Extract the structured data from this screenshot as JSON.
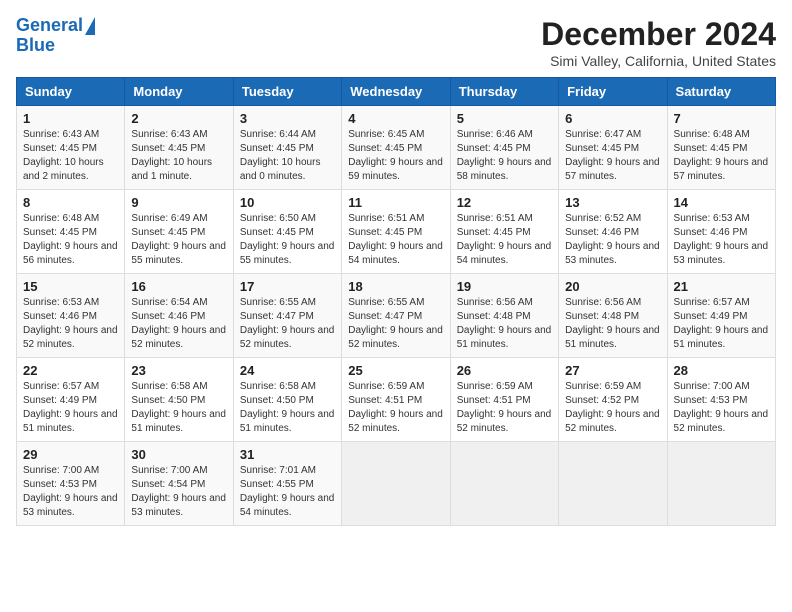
{
  "header": {
    "logo_line1": "General",
    "logo_line2": "Blue",
    "title": "December 2024",
    "subtitle": "Simi Valley, California, United States"
  },
  "days_of_week": [
    "Sunday",
    "Monday",
    "Tuesday",
    "Wednesday",
    "Thursday",
    "Friday",
    "Saturday"
  ],
  "weeks": [
    [
      {
        "day": "1",
        "sunrise": "6:43 AM",
        "sunset": "4:45 PM",
        "daylight": "10 hours and 2 minutes."
      },
      {
        "day": "2",
        "sunrise": "6:43 AM",
        "sunset": "4:45 PM",
        "daylight": "10 hours and 1 minute."
      },
      {
        "day": "3",
        "sunrise": "6:44 AM",
        "sunset": "4:45 PM",
        "daylight": "10 hours and 0 minutes."
      },
      {
        "day": "4",
        "sunrise": "6:45 AM",
        "sunset": "4:45 PM",
        "daylight": "9 hours and 59 minutes."
      },
      {
        "day": "5",
        "sunrise": "6:46 AM",
        "sunset": "4:45 PM",
        "daylight": "9 hours and 58 minutes."
      },
      {
        "day": "6",
        "sunrise": "6:47 AM",
        "sunset": "4:45 PM",
        "daylight": "9 hours and 57 minutes."
      },
      {
        "day": "7",
        "sunrise": "6:48 AM",
        "sunset": "4:45 PM",
        "daylight": "9 hours and 57 minutes."
      }
    ],
    [
      {
        "day": "8",
        "sunrise": "6:48 AM",
        "sunset": "4:45 PM",
        "daylight": "9 hours and 56 minutes."
      },
      {
        "day": "9",
        "sunrise": "6:49 AM",
        "sunset": "4:45 PM",
        "daylight": "9 hours and 55 minutes."
      },
      {
        "day": "10",
        "sunrise": "6:50 AM",
        "sunset": "4:45 PM",
        "daylight": "9 hours and 55 minutes."
      },
      {
        "day": "11",
        "sunrise": "6:51 AM",
        "sunset": "4:45 PM",
        "daylight": "9 hours and 54 minutes."
      },
      {
        "day": "12",
        "sunrise": "6:51 AM",
        "sunset": "4:45 PM",
        "daylight": "9 hours and 54 minutes."
      },
      {
        "day": "13",
        "sunrise": "6:52 AM",
        "sunset": "4:46 PM",
        "daylight": "9 hours and 53 minutes."
      },
      {
        "day": "14",
        "sunrise": "6:53 AM",
        "sunset": "4:46 PM",
        "daylight": "9 hours and 53 minutes."
      }
    ],
    [
      {
        "day": "15",
        "sunrise": "6:53 AM",
        "sunset": "4:46 PM",
        "daylight": "9 hours and 52 minutes."
      },
      {
        "day": "16",
        "sunrise": "6:54 AM",
        "sunset": "4:46 PM",
        "daylight": "9 hours and 52 minutes."
      },
      {
        "day": "17",
        "sunrise": "6:55 AM",
        "sunset": "4:47 PM",
        "daylight": "9 hours and 52 minutes."
      },
      {
        "day": "18",
        "sunrise": "6:55 AM",
        "sunset": "4:47 PM",
        "daylight": "9 hours and 52 minutes."
      },
      {
        "day": "19",
        "sunrise": "6:56 AM",
        "sunset": "4:48 PM",
        "daylight": "9 hours and 51 minutes."
      },
      {
        "day": "20",
        "sunrise": "6:56 AM",
        "sunset": "4:48 PM",
        "daylight": "9 hours and 51 minutes."
      },
      {
        "day": "21",
        "sunrise": "6:57 AM",
        "sunset": "4:49 PM",
        "daylight": "9 hours and 51 minutes."
      }
    ],
    [
      {
        "day": "22",
        "sunrise": "6:57 AM",
        "sunset": "4:49 PM",
        "daylight": "9 hours and 51 minutes."
      },
      {
        "day": "23",
        "sunrise": "6:58 AM",
        "sunset": "4:50 PM",
        "daylight": "9 hours and 51 minutes."
      },
      {
        "day": "24",
        "sunrise": "6:58 AM",
        "sunset": "4:50 PM",
        "daylight": "9 hours and 51 minutes."
      },
      {
        "day": "25",
        "sunrise": "6:59 AM",
        "sunset": "4:51 PM",
        "daylight": "9 hours and 52 minutes."
      },
      {
        "day": "26",
        "sunrise": "6:59 AM",
        "sunset": "4:51 PM",
        "daylight": "9 hours and 52 minutes."
      },
      {
        "day": "27",
        "sunrise": "6:59 AM",
        "sunset": "4:52 PM",
        "daylight": "9 hours and 52 minutes."
      },
      {
        "day": "28",
        "sunrise": "7:00 AM",
        "sunset": "4:53 PM",
        "daylight": "9 hours and 52 minutes."
      }
    ],
    [
      {
        "day": "29",
        "sunrise": "7:00 AM",
        "sunset": "4:53 PM",
        "daylight": "9 hours and 53 minutes."
      },
      {
        "day": "30",
        "sunrise": "7:00 AM",
        "sunset": "4:54 PM",
        "daylight": "9 hours and 53 minutes."
      },
      {
        "day": "31",
        "sunrise": "7:01 AM",
        "sunset": "4:55 PM",
        "daylight": "9 hours and 54 minutes."
      },
      null,
      null,
      null,
      null
    ]
  ]
}
